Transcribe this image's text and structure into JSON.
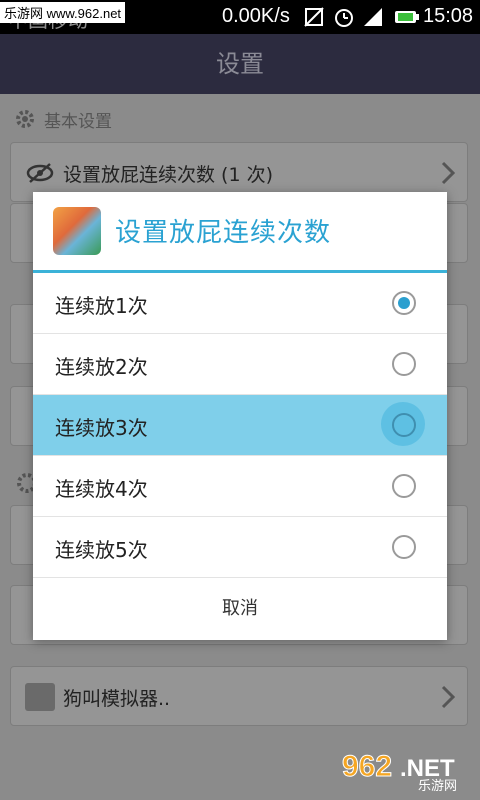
{
  "status_bar": {
    "carrier": "中国移动",
    "watermark": "乐游网 www.962.net",
    "net_speed": "0.00K/s",
    "time": "15:08"
  },
  "app_bar": {
    "title": "设置"
  },
  "background": {
    "section_title": "基本设置",
    "row_1_label": "设置放屁连续次数 (1 次)",
    "last_row_label": "狗叫模拟器.."
  },
  "dialog": {
    "title": "设置放屁连续次数",
    "options": [
      {
        "label": "连续放1次",
        "checked": true
      },
      {
        "label": "连续放2次",
        "checked": false
      },
      {
        "label": "连续放3次",
        "checked": false,
        "highlighted": true
      },
      {
        "label": "连续放4次",
        "checked": false
      },
      {
        "label": "连续放5次",
        "checked": false
      }
    ],
    "cancel_label": "取消"
  },
  "bottom_watermark": {
    "site": "962",
    "suffix": ".NET",
    "subtitle": "乐游网"
  },
  "colors": {
    "accent": "#3bb2d8",
    "highlight": "#7fcfea",
    "radio_dot": "#2b9fcf"
  }
}
